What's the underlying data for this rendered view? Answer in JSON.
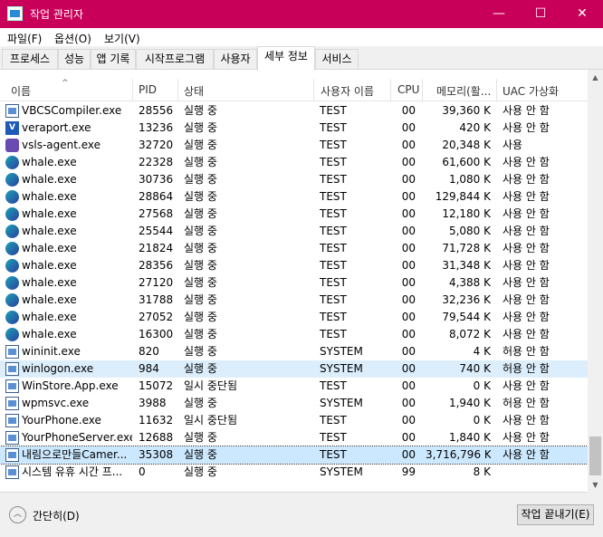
{
  "window": {
    "title": "작업 관리자",
    "min_glyph": "—",
    "max_glyph": "☐",
    "close_glyph": "✕"
  },
  "menu": [
    "파일(F)",
    "옵션(O)",
    "보기(V)"
  ],
  "tabs": [
    "프로세스",
    "성능",
    "앱 기록",
    "시작프로그램",
    "사용자",
    "세부 정보",
    "서비스"
  ],
  "active_tab": "세부 정보",
  "columns": [
    "이름",
    "PID",
    "상태",
    "사용자 이름",
    "CPU",
    "메모리(활...",
    "UAC 가상화"
  ],
  "rows": [
    {
      "icon": "window",
      "name": "VBCSCompiler.exe",
      "pid": "28556",
      "status": "실행 중",
      "user": "TEST",
      "cpu": "00",
      "mem": "39,360 K",
      "uac": "사용 안 함"
    },
    {
      "icon": "vp",
      "name": "veraport.exe",
      "pid": "13236",
      "status": "실행 중",
      "user": "TEST",
      "cpu": "00",
      "mem": "420 K",
      "uac": "사용 안 함"
    },
    {
      "icon": "vs",
      "name": "vsls-agent.exe",
      "pid": "32720",
      "status": "실행 중",
      "user": "TEST",
      "cpu": "00",
      "mem": "20,348 K",
      "uac": "사용"
    },
    {
      "icon": "whale",
      "name": "whale.exe",
      "pid": "22328",
      "status": "실행 중",
      "user": "TEST",
      "cpu": "00",
      "mem": "61,600 K",
      "uac": "사용 안 함"
    },
    {
      "icon": "whale",
      "name": "whale.exe",
      "pid": "30736",
      "status": "실행 중",
      "user": "TEST",
      "cpu": "00",
      "mem": "1,080 K",
      "uac": "사용 안 함"
    },
    {
      "icon": "whale",
      "name": "whale.exe",
      "pid": "28864",
      "status": "실행 중",
      "user": "TEST",
      "cpu": "00",
      "mem": "129,844 K",
      "uac": "사용 안 함"
    },
    {
      "icon": "whale",
      "name": "whale.exe",
      "pid": "27568",
      "status": "실행 중",
      "user": "TEST",
      "cpu": "00",
      "mem": "12,180 K",
      "uac": "사용 안 함"
    },
    {
      "icon": "whale",
      "name": "whale.exe",
      "pid": "25544",
      "status": "실행 중",
      "user": "TEST",
      "cpu": "00",
      "mem": "5,080 K",
      "uac": "사용 안 함"
    },
    {
      "icon": "whale",
      "name": "whale.exe",
      "pid": "21824",
      "status": "실행 중",
      "user": "TEST",
      "cpu": "00",
      "mem": "71,728 K",
      "uac": "사용 안 함"
    },
    {
      "icon": "whale",
      "name": "whale.exe",
      "pid": "28356",
      "status": "실행 중",
      "user": "TEST",
      "cpu": "00",
      "mem": "31,348 K",
      "uac": "사용 안 함"
    },
    {
      "icon": "whale",
      "name": "whale.exe",
      "pid": "27120",
      "status": "실행 중",
      "user": "TEST",
      "cpu": "00",
      "mem": "4,388 K",
      "uac": "사용 안 함"
    },
    {
      "icon": "whale",
      "name": "whale.exe",
      "pid": "31788",
      "status": "실행 중",
      "user": "TEST",
      "cpu": "00",
      "mem": "32,236 K",
      "uac": "사용 안 함"
    },
    {
      "icon": "whale",
      "name": "whale.exe",
      "pid": "27052",
      "status": "실행 중",
      "user": "TEST",
      "cpu": "00",
      "mem": "79,544 K",
      "uac": "사용 안 함"
    },
    {
      "icon": "whale",
      "name": "whale.exe",
      "pid": "16300",
      "status": "실행 중",
      "user": "TEST",
      "cpu": "00",
      "mem": "8,072 K",
      "uac": "사용 안 함"
    },
    {
      "icon": "window",
      "name": "wininit.exe",
      "pid": "820",
      "status": "실행 중",
      "user": "SYSTEM",
      "cpu": "00",
      "mem": "4 K",
      "uac": "허용 안 함"
    },
    {
      "icon": "window",
      "name": "winlogon.exe",
      "pid": "984",
      "status": "실행 중",
      "user": "SYSTEM",
      "cpu": "00",
      "mem": "740 K",
      "uac": "허용 안 함",
      "state": "hover"
    },
    {
      "icon": "window",
      "name": "WinStore.App.exe",
      "pid": "15072",
      "status": "일시 중단됨",
      "user": "TEST",
      "cpu": "00",
      "mem": "0 K",
      "uac": "사용 안 함"
    },
    {
      "icon": "window",
      "name": "wpmsvc.exe",
      "pid": "3988",
      "status": "실행 중",
      "user": "SYSTEM",
      "cpu": "00",
      "mem": "1,940 K",
      "uac": "허용 안 함"
    },
    {
      "icon": "window",
      "name": "YourPhone.exe",
      "pid": "11632",
      "status": "일시 중단됨",
      "user": "TEST",
      "cpu": "00",
      "mem": "0 K",
      "uac": "사용 안 함"
    },
    {
      "icon": "window",
      "name": "YourPhoneServer.exe",
      "pid": "12688",
      "status": "실행 중",
      "user": "TEST",
      "cpu": "00",
      "mem": "1,840 K",
      "uac": "사용 안 함"
    },
    {
      "icon": "window",
      "name": "내림으로만들Camer...",
      "pid": "35308",
      "status": "실행 중",
      "user": "TEST",
      "cpu": "00",
      "mem": "3,716,796 K",
      "uac": "사용 안 함",
      "state": "selected"
    },
    {
      "icon": "window",
      "name": "시스템 유휴 시간 프...",
      "pid": "0",
      "status": "실행 중",
      "user": "SYSTEM",
      "cpu": "99",
      "mem": "8 K",
      "uac": ""
    }
  ],
  "footer": {
    "collapse_label": "간단히(D)",
    "end_task_label": "작업 끝내기(E)"
  }
}
